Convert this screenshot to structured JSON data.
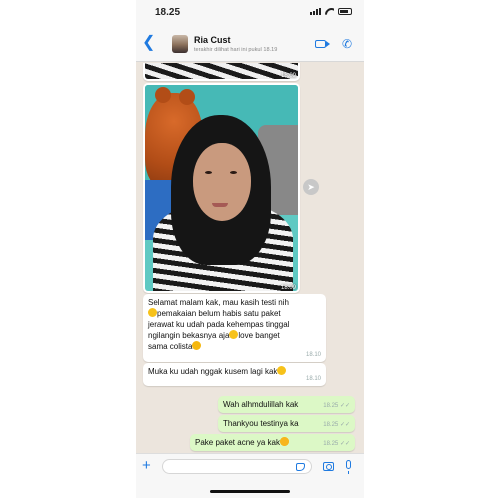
{
  "status": {
    "time": "18.25"
  },
  "header": {
    "contact_name": "Ria Cust",
    "last_seen": "terakhir dilihat hari ini pukul 18.19",
    "back_icon": "chevron-left-icon",
    "video_icon": "video-icon",
    "call_icon": "phone-icon"
  },
  "messages": [
    {
      "type": "image",
      "direction": "in",
      "time": "18.09"
    },
    {
      "type": "image",
      "direction": "in",
      "time": "18.09"
    },
    {
      "type": "text",
      "direction": "in",
      "lines": [
        "Selamat malam kak, mau kasih testi nih",
        "pemakaian belum habis satu paket",
        "jerawat ku udah pada kehempas tinggal",
        "ngilangin bekasnya aja",
        "love banget",
        "sama colista"
      ],
      "time": "18.10"
    },
    {
      "type": "text",
      "direction": "in",
      "text": "Muka ku udah nggak kusem lagi kak",
      "time": "18.10"
    },
    {
      "type": "text",
      "direction": "out",
      "text": "Wah  alhmdulillah kak",
      "time": "18.25"
    },
    {
      "type": "text",
      "direction": "out",
      "text": "Thankyou testinya ka",
      "time": "18.25"
    },
    {
      "type": "text",
      "direction": "out",
      "text": "Pake paket acne ya kak",
      "time": "18.25"
    }
  ],
  "input": {
    "placeholder": ""
  },
  "colors": {
    "accent": "#1f7ae0",
    "out_bubble": "#dcf8c6",
    "in_bubble": "#ffffff",
    "chat_bg": "#ece5dd"
  }
}
